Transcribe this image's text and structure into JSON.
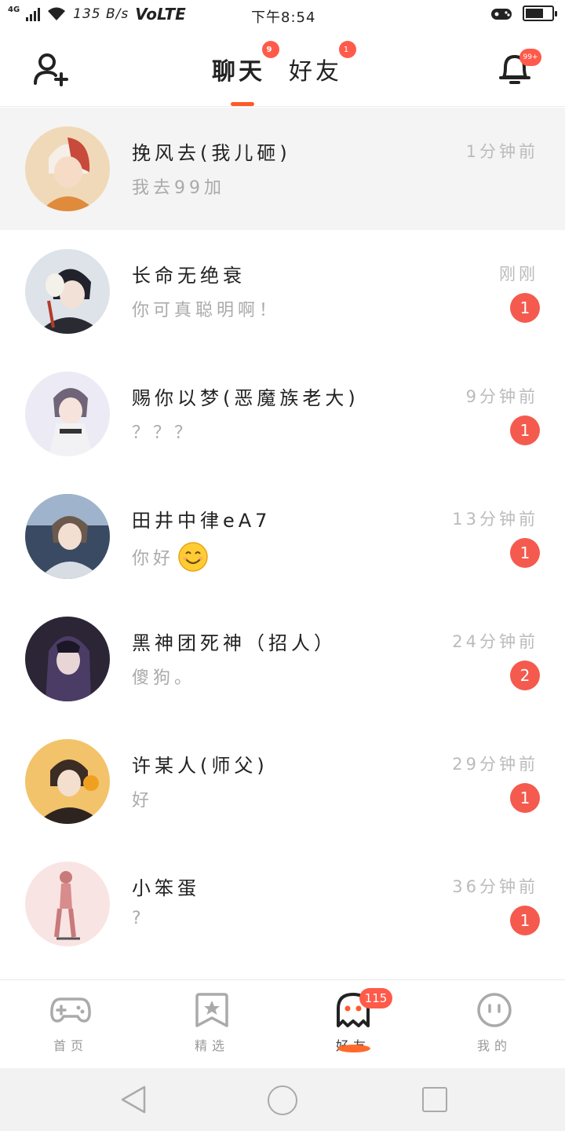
{
  "status_bar": {
    "network": "4G",
    "speed": "135 B/s",
    "volte": "VoLTE",
    "time": "下午8:54",
    "battery_level": 0.7
  },
  "header": {
    "tabs": [
      {
        "label": "聊天",
        "badge": "9",
        "active": true
      },
      {
        "label": "好友",
        "badge": "1",
        "active": false
      }
    ],
    "bell_badge": "99+",
    "icons": {
      "left": "add-friend-icon",
      "right": "bell-icon"
    }
  },
  "chats": [
    {
      "name": "挽风去(我儿砸)",
      "message": "我去99加",
      "time": "1分钟前",
      "unread": "",
      "avatar_colors": [
        "#e6c9a8",
        "#c84a3a"
      ]
    },
    {
      "name": "长命无绝衰",
      "message": "你可真聪明啊！",
      "time": "刚刚",
      "unread": "1",
      "avatar_colors": [
        "#dde3e8",
        "#2a2a33"
      ]
    },
    {
      "name": "赐你以梦(恶魔族老大)",
      "message": "？？？",
      "time": "9分钟前",
      "unread": "1",
      "avatar_colors": [
        "#eceaf5",
        "#6f6478"
      ]
    },
    {
      "name": "田井中律eA7",
      "message": "你好",
      "emoji": "smile",
      "time": "13分钟前",
      "unread": "1",
      "avatar_colors": [
        "#3a4a62",
        "#9fb4cc"
      ]
    },
    {
      "name": "黑神团死神（招人）",
      "message": "傻狗。",
      "time": "24分钟前",
      "unread": "2",
      "avatar_colors": [
        "#2b2536",
        "#7c6a98"
      ]
    },
    {
      "name": "许某人(师父)",
      "message": "好",
      "time": "29分钟前",
      "unread": "1",
      "avatar_colors": [
        "#f2c36a",
        "#3b2c24"
      ]
    },
    {
      "name": "小笨蛋",
      "message": "?",
      "time": "36分钟前",
      "unread": "1",
      "avatar_colors": [
        "#f9e4e4",
        "#c87a7a"
      ]
    }
  ],
  "bottom_nav": {
    "items": [
      {
        "label": "首页",
        "icon": "gamepad-icon",
        "active": false
      },
      {
        "label": "精选",
        "icon": "star-bookmark-icon",
        "active": false
      },
      {
        "label": "好友",
        "icon": "ghost-icon",
        "active": true,
        "badge": "115"
      },
      {
        "label": "我的",
        "icon": "face-icon",
        "active": false
      }
    ]
  },
  "system_nav": {
    "icons": [
      "back-icon",
      "home-icon",
      "recents-icon"
    ]
  },
  "colors": {
    "accent": "#ff5a28",
    "badge": "#f55a4e",
    "muted": "#aaaaaa"
  }
}
